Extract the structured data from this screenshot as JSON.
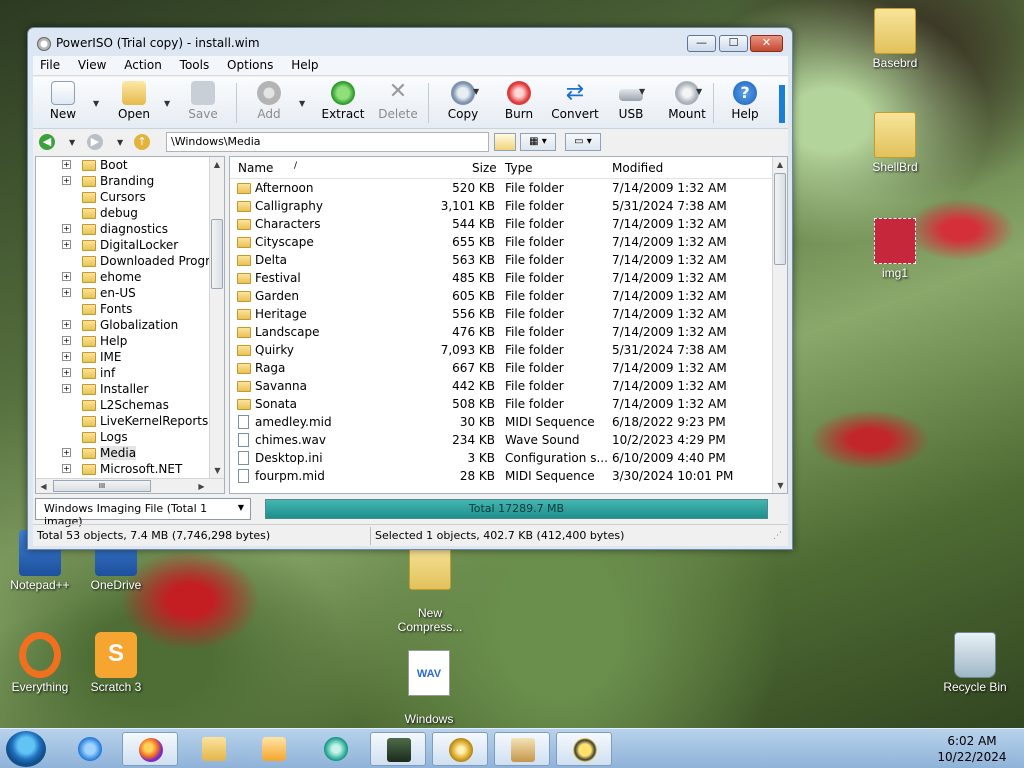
{
  "window": {
    "title": "PowerISO (Trial copy) - install.wim",
    "min_glyph": "—",
    "max_glyph": "☐",
    "close_glyph": "✕"
  },
  "menu": [
    "File",
    "View",
    "Action",
    "Tools",
    "Options",
    "Help"
  ],
  "toolbar": {
    "new": "New",
    "open": "Open",
    "save": "Save",
    "add": "Add",
    "extract": "Extract",
    "delete": "Delete",
    "copy": "Copy",
    "burn": "Burn",
    "convert": "Convert",
    "usb": "USB",
    "mount": "Mount",
    "help": "Help"
  },
  "address": {
    "path": "\\Windows\\Media"
  },
  "tree": {
    "items": [
      {
        "label": "Boot",
        "expander": "+"
      },
      {
        "label": "Branding",
        "expander": "+"
      },
      {
        "label": "Cursors",
        "expander": ""
      },
      {
        "label": "debug",
        "expander": ""
      },
      {
        "label": "diagnostics",
        "expander": "+"
      },
      {
        "label": "DigitalLocker",
        "expander": "+"
      },
      {
        "label": "Downloaded Progra",
        "expander": ""
      },
      {
        "label": "ehome",
        "expander": "+"
      },
      {
        "label": "en-US",
        "expander": "+"
      },
      {
        "label": "Fonts",
        "expander": ""
      },
      {
        "label": "Globalization",
        "expander": "+"
      },
      {
        "label": "Help",
        "expander": "+"
      },
      {
        "label": "IME",
        "expander": "+"
      },
      {
        "label": "inf",
        "expander": "+"
      },
      {
        "label": "Installer",
        "expander": "+"
      },
      {
        "label": "L2Schemas",
        "expander": ""
      },
      {
        "label": "LiveKernelReports",
        "expander": ""
      },
      {
        "label": "Logs",
        "expander": ""
      },
      {
        "label": "Media",
        "expander": "+"
      },
      {
        "label": "Microsoft.NET",
        "expander": "+"
      }
    ],
    "hscroll_grip": "III"
  },
  "list": {
    "headers": {
      "name": "Name",
      "size": "Size",
      "type": "Type",
      "modified": "Modified"
    },
    "sort_arrow": "/",
    "rows": [
      {
        "name": "Afternoon",
        "size": "520 KB",
        "type": "File folder",
        "modified": "7/14/2009 1:32 AM",
        "kind": "folder"
      },
      {
        "name": "Calligraphy",
        "size": "3,101 KB",
        "type": "File folder",
        "modified": "5/31/2024 7:38 AM",
        "kind": "folder"
      },
      {
        "name": "Characters",
        "size": "544 KB",
        "type": "File folder",
        "modified": "7/14/2009 1:32 AM",
        "kind": "folder"
      },
      {
        "name": "Cityscape",
        "size": "655 KB",
        "type": "File folder",
        "modified": "7/14/2009 1:32 AM",
        "kind": "folder"
      },
      {
        "name": "Delta",
        "size": "563 KB",
        "type": "File folder",
        "modified": "7/14/2009 1:32 AM",
        "kind": "folder"
      },
      {
        "name": "Festival",
        "size": "485 KB",
        "type": "File folder",
        "modified": "7/14/2009 1:32 AM",
        "kind": "folder"
      },
      {
        "name": "Garden",
        "size": "605 KB",
        "type": "File folder",
        "modified": "7/14/2009 1:32 AM",
        "kind": "folder"
      },
      {
        "name": "Heritage",
        "size": "556 KB",
        "type": "File folder",
        "modified": "7/14/2009 1:32 AM",
        "kind": "folder"
      },
      {
        "name": "Landscape",
        "size": "476 KB",
        "type": "File folder",
        "modified": "7/14/2009 1:32 AM",
        "kind": "folder"
      },
      {
        "name": "Quirky",
        "size": "7,093 KB",
        "type": "File folder",
        "modified": "5/31/2024 7:38 AM",
        "kind": "folder"
      },
      {
        "name": "Raga",
        "size": "667 KB",
        "type": "File folder",
        "modified": "7/14/2009 1:32 AM",
        "kind": "folder"
      },
      {
        "name": "Savanna",
        "size": "442 KB",
        "type": "File folder",
        "modified": "7/14/2009 1:32 AM",
        "kind": "folder"
      },
      {
        "name": "Sonata",
        "size": "508 KB",
        "type": "File folder",
        "modified": "7/14/2009 1:32 AM",
        "kind": "folder"
      },
      {
        "name": "amedley.mid",
        "size": "30 KB",
        "type": "MIDI Sequence",
        "modified": "6/18/2022 9:23 PM",
        "kind": "file"
      },
      {
        "name": "chimes.wav",
        "size": "234 KB",
        "type": "Wave Sound",
        "modified": "10/2/2023 4:29 PM",
        "kind": "file"
      },
      {
        "name": "Desktop.ini",
        "size": "3 KB",
        "type": "Configuration s...",
        "modified": "6/10/2009 4:40 PM",
        "kind": "file"
      },
      {
        "name": "fourpm.mid",
        "size": "28 KB",
        "type": "MIDI Sequence",
        "modified": "3/30/2024 10:01 PM",
        "kind": "file"
      }
    ]
  },
  "image_type": {
    "value": "Windows Imaging File (Total 1 image)"
  },
  "progress": {
    "label": "Total 17289.7 MB",
    "fraction": 1.0
  },
  "status": {
    "left": "Total 53 objects, 7.4 MB (7,746,298 bytes)",
    "right": "Selected 1 objects, 402.7 KB (412,400 bytes)"
  },
  "desktop_icons": {
    "basebrd": "Basebrd",
    "shellbrd": "ShellBrd",
    "img1": "img1",
    "notepadpp": "Notepad++",
    "onedrive": "OneDrive",
    "newcompress": "New\nCompress...",
    "everything": "Everything",
    "scratch": "Scratch 3",
    "logon_sound": "Windows\nLogon Sound",
    "recycle": "Recycle Bin",
    "wav_badge": "WAV",
    "scratch_badge": "S"
  },
  "clock": {
    "time": "6:02 AM",
    "date": "10/22/2024"
  },
  "colors": {
    "accent": "#1a7fd4",
    "progress": "#2fa3a0",
    "taskbar": "#a9c7e6"
  }
}
